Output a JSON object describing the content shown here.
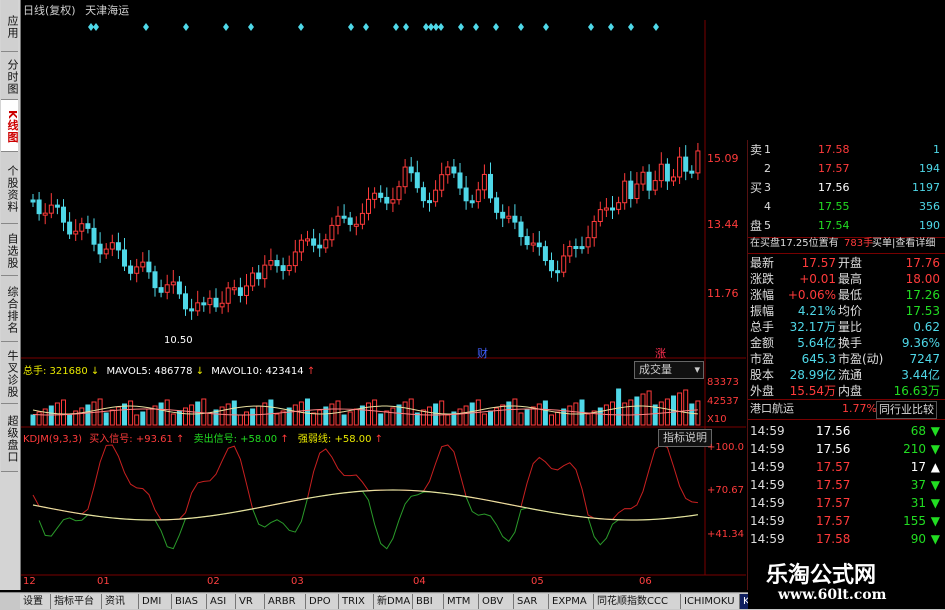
{
  "left_tabs": [
    "应用",
    "分时图",
    "K线图",
    "个股资料",
    "自选股",
    "综合排名",
    "牛叉诊股",
    "超级盘口"
  ],
  "header": {
    "title": "日线(复权)",
    "stock": "天津海运"
  },
  "price_axis": [
    "15.09",
    "13.44",
    "11.76"
  ],
  "low_label": "10.50",
  "markers": [
    "财",
    "涨"
  ],
  "volume": {
    "label_total": "总手: 321680",
    "label_ma5": "MAVOL5: 486778",
    "label_ma10": "MAVOL10: 423414",
    "dropdown": "成交量",
    "axis": [
      "83373",
      "42537",
      "X10"
    ]
  },
  "kdj": {
    "label_name": "KDJM(9,3,3)",
    "label_buy": "买入信号: +93.61",
    "label_sell": "卖出信号: +58.00",
    "label_strong": "强弱线: +58.00",
    "button": "指标说明",
    "axis": [
      "+100.0",
      "+70.67",
      "+41.34"
    ]
  },
  "time_axis": [
    "12",
    "01",
    "02",
    "03",
    "04",
    "05",
    "06"
  ],
  "order_book": [
    {
      "label": "卖",
      "level": "1",
      "price": "17.58",
      "vol": "1"
    },
    {
      "label": "",
      "level": "2",
      "price": "17.57",
      "vol": "194"
    },
    {
      "label": "买",
      "level": "3",
      "price": "17.56",
      "vol": "1197"
    },
    {
      "label": "",
      "level": "4",
      "price": "17.55",
      "vol": "356"
    },
    {
      "label": "盘",
      "level": "5",
      "price": "17.54",
      "vol": "190"
    }
  ],
  "buy_info": {
    "text": "在买盘17.25位置有",
    "qty": "783手",
    "detail": "买单|查看详细"
  },
  "quote": [
    {
      "k1": "最新",
      "v1": "17.57",
      "k2": "开盘",
      "v2": "17.76"
    },
    {
      "k1": "涨跌",
      "v1": "+0.01",
      "k2": "最高",
      "v2": "18.00"
    },
    {
      "k1": "涨幅",
      "v1": "+0.06%",
      "k2": "最低",
      "v2": "17.26"
    },
    {
      "k1": "振幅",
      "v1": "4.21%",
      "k2": "均价",
      "v2": "17.53"
    },
    {
      "k1": "总手",
      "v1": "32.17万",
      "k2": "量比",
      "v2": "0.62"
    },
    {
      "k1": "金额",
      "v1": "5.64亿",
      "k2": "换手",
      "v2": "9.36%"
    },
    {
      "k1": "市盈",
      "v1": "645.3",
      "k2": "市盈(动)",
      "v2": "7247"
    },
    {
      "k1": "股本",
      "v1": "28.99亿",
      "k2": "流通",
      "v2": "3.44亿"
    },
    {
      "k1": "外盘",
      "v1": "15.54万",
      "k2": "内盘",
      "v2": "16.63万"
    }
  ],
  "sector": {
    "name": "港口航运",
    "pct": "1.77%",
    "button": "同行业比较"
  },
  "ticks": [
    {
      "time": "14:59",
      "price": "17.56",
      "vol": "68",
      "dir": "down"
    },
    {
      "time": "14:59",
      "price": "17.56",
      "vol": "210",
      "dir": "down"
    },
    {
      "time": "14:59",
      "price": "17.57",
      "vol": "17",
      "dir": "up"
    },
    {
      "time": "14:59",
      "price": "17.57",
      "vol": "37",
      "dir": "down"
    },
    {
      "time": "14:59",
      "price": "17.57",
      "vol": "31",
      "dir": "down"
    },
    {
      "time": "14:59",
      "price": "17.57",
      "vol": "155",
      "dir": "down"
    },
    {
      "time": "14:59",
      "price": "17.58",
      "vol": "90",
      "dir": "down"
    }
  ],
  "bottom_tabs": [
    "设置",
    "指标平台",
    "资讯",
    "DMI",
    "BIAS",
    "ASI",
    "VR",
    "ARBR",
    "DPO",
    "TRIX",
    "新DMA",
    "BBI",
    "MTM",
    "OBV",
    "SAR",
    "EXPMA",
    "同花顺指数CCC",
    "ICHIMOKU",
    "KDJM"
  ],
  "watermark": {
    "title": "乐淘公式网",
    "url": "www.60lt.com"
  },
  "colors": {
    "up": "#ff3b3b",
    "down": "#4fd8e8",
    "kline_k": "#e8e0a0",
    "kdj_red": "#c82020",
    "kdj_green": "#2a9a2a"
  }
}
